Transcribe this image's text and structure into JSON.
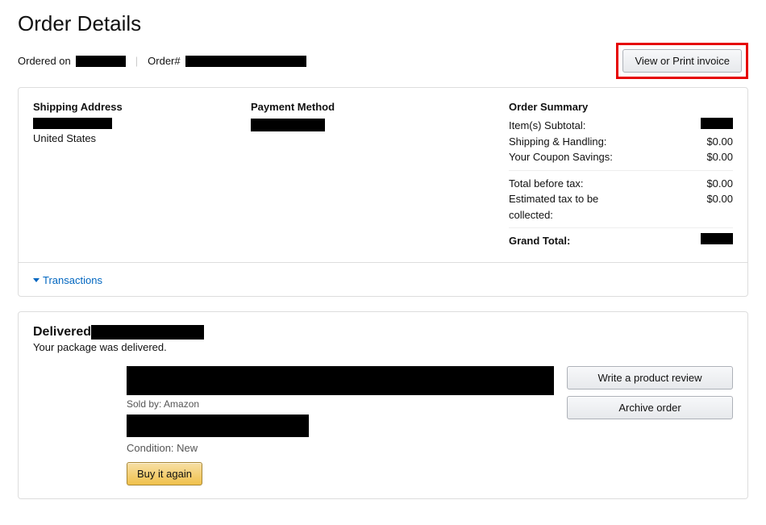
{
  "pageTitle": "Order Details",
  "meta": {
    "orderedOnLabel": "Ordered on",
    "orderNumLabel": "Order#"
  },
  "invoiceButton": "View or Print invoice",
  "shipping": {
    "heading": "Shipping Address",
    "country": "United States"
  },
  "payment": {
    "heading": "Payment Method"
  },
  "summary": {
    "heading": "Order Summary",
    "rows": {
      "subtotalLabel": "Item(s) Subtotal:",
      "shippingLabel": "Shipping & Handling:",
      "shippingValue": "$0.00",
      "couponLabel": "Your Coupon Savings:",
      "couponValue": "$0.00",
      "totalBeforeTaxLabel": "Total before tax:",
      "totalBeforeTaxValue": "$0.00",
      "taxLabel": "Estimated tax to be collected:",
      "taxValue": "$0.00",
      "grandTotalLabel": "Grand Total:"
    }
  },
  "transactionsLabel": "Transactions",
  "delivery": {
    "status": "Delivered",
    "message": "Your package was delivered."
  },
  "item": {
    "soldByLabel": "Sold by:",
    "soldByValue": "Amazon",
    "conditionLabel": "Condition:",
    "conditionValue": "New",
    "buyAgain": "Buy it again"
  },
  "actions": {
    "review": "Write a product review",
    "archive": "Archive order"
  }
}
